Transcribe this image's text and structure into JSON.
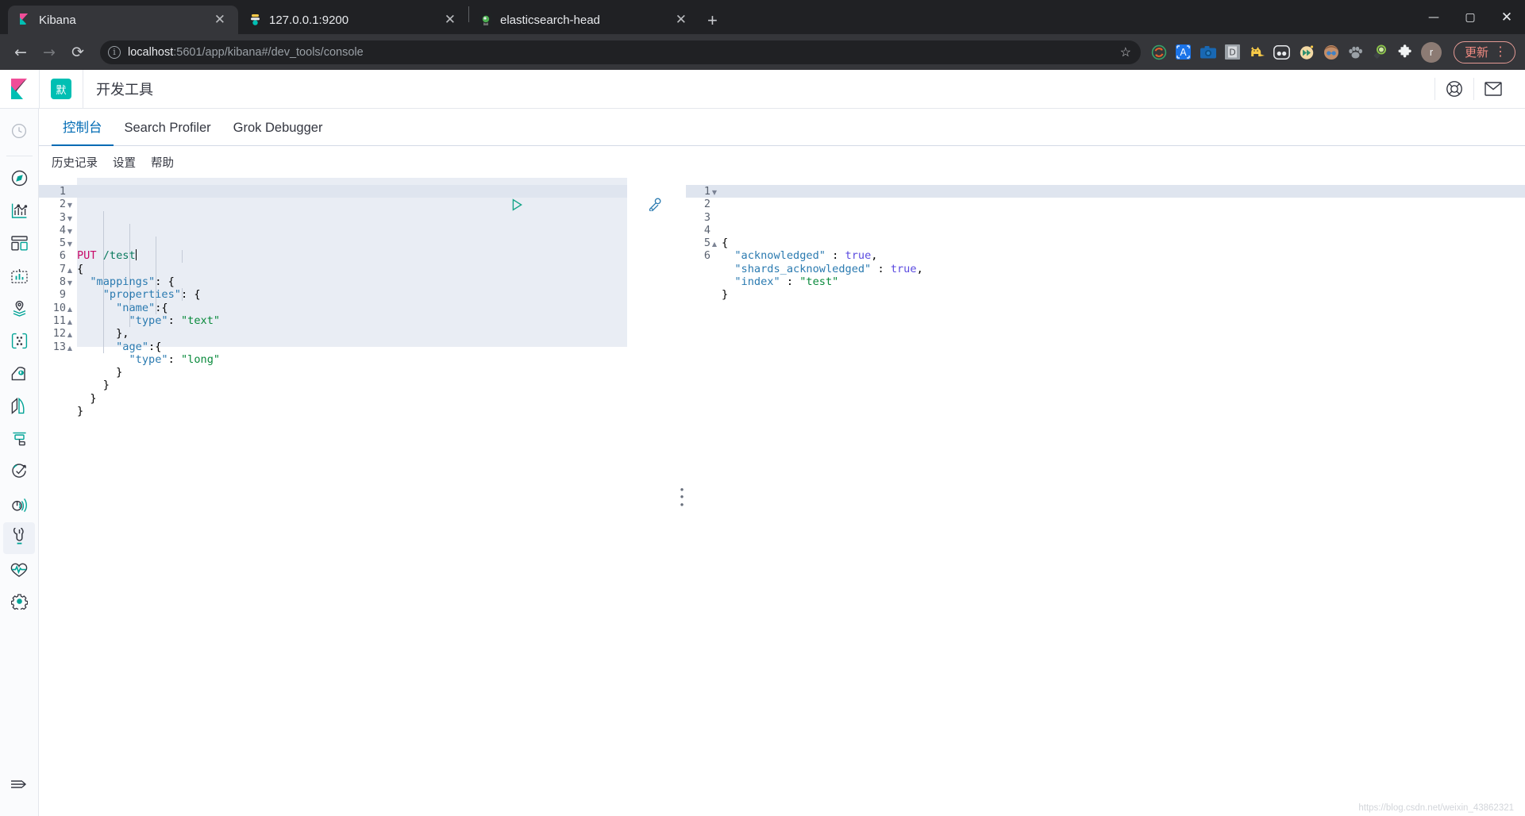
{
  "browser": {
    "tabs": [
      {
        "title": "Kibana",
        "favicon": "kibana-icon",
        "active": true,
        "close_label": "✕"
      },
      {
        "title": "127.0.0.1:9200",
        "favicon": "elasticsearch-icon",
        "active": false,
        "close_label": "✕"
      },
      {
        "title": "elasticsearch-head",
        "favicon": "es-head-icon",
        "active": false,
        "close_label": "✕"
      }
    ],
    "new_tab_label": "+",
    "window_controls": {
      "minimize": "—",
      "maximize": "▢",
      "close": "✕"
    },
    "nav": {
      "back": "←",
      "forward": "→",
      "reload": "⟳"
    },
    "url": {
      "info_glyph": "i",
      "host": "localhost",
      "rest": ":5601/app/kibana#/dev_tools/console",
      "full": "localhost:5601/app/kibana#/dev_tools/console",
      "bookmark_star": "☆"
    },
    "extensions": [
      {
        "name": "sync-extension-icon",
        "glyph": "⟳",
        "color": "#e8622c"
      },
      {
        "name": "letter-a-extension-icon",
        "glyph": "A",
        "color": "#1a73e8"
      },
      {
        "name": "camera-extension-icon",
        "glyph": "📷",
        "color": "#1968b3"
      },
      {
        "name": "letter-d-extension-icon",
        "glyph": "D",
        "color": "#9aa0a6"
      },
      {
        "name": "cat-extension-icon",
        "glyph": "🐈",
        "color": "#f7c948"
      },
      {
        "name": "pocket-extension-icon",
        "glyph": "◠",
        "color": "#e8eaed"
      },
      {
        "name": "fast-forward-extension-icon",
        "glyph": "▶",
        "color": "#f3d9a4"
      },
      {
        "name": "avatar-extension-icon",
        "glyph": "😎",
        "color": "#c28e6a"
      },
      {
        "name": "paw-extension-icon",
        "glyph": "🐾",
        "color": "#9aa0a6"
      },
      {
        "name": "magnifier-extension-icon",
        "glyph": "🔍",
        "color": "#8bc34a"
      },
      {
        "name": "puzzle-extensions-icon",
        "glyph": "🧩",
        "color": "#e8eaed"
      }
    ],
    "profile_initial": "r",
    "update_button_label": "更新",
    "menu_glyph": "⋮"
  },
  "kibana": {
    "logo_name": "kibana-logo",
    "space_badge": "默",
    "app_title": "开发工具",
    "header_icons": [
      {
        "name": "help-lifebuoy-icon",
        "glyph": "help"
      },
      {
        "name": "newsfeed-mail-icon",
        "glyph": "mail"
      }
    ],
    "nav_items": [
      {
        "name": "recently-viewed",
        "icon": "clock-icon",
        "active": false
      },
      {
        "name": "discover",
        "icon": "compass-icon",
        "active": false
      },
      {
        "name": "visualize",
        "icon": "bar-chart-icon",
        "active": false
      },
      {
        "name": "dashboard",
        "icon": "dashboard-grid-icon",
        "active": false
      },
      {
        "name": "canvas",
        "icon": "canvas-frame-icon",
        "active": false
      },
      {
        "name": "maps",
        "icon": "map-pin-layers-icon",
        "active": false
      },
      {
        "name": "machine-learning",
        "icon": "ml-nodes-icon",
        "active": false
      },
      {
        "name": "infrastructure",
        "icon": "infra-icon",
        "active": false
      },
      {
        "name": "logs",
        "icon": "logs-icon",
        "active": false
      },
      {
        "name": "apm",
        "icon": "apm-icon",
        "active": false
      },
      {
        "name": "uptime",
        "icon": "uptime-check-icon",
        "active": false
      },
      {
        "name": "siem",
        "icon": "siem-radar-icon",
        "active": false
      },
      {
        "name": "dev-tools",
        "icon": "wrench-icon",
        "active": true
      },
      {
        "name": "monitoring",
        "icon": "heartbeat-icon",
        "active": false
      },
      {
        "name": "management",
        "icon": "gear-icon",
        "active": false
      }
    ],
    "nav_collapse": {
      "name": "collapse-nav",
      "icon": "collapse-arrow-icon"
    },
    "tabs": [
      {
        "label": "控制台",
        "active": true
      },
      {
        "label": "Search Profiler",
        "active": false
      },
      {
        "label": "Grok Debugger",
        "active": false
      }
    ],
    "console_toolbar": [
      {
        "label": "历史记录"
      },
      {
        "label": "设置"
      },
      {
        "label": "帮助"
      }
    ],
    "editor": {
      "line_count": 13,
      "current_line": 1,
      "folds": {
        "2": "down",
        "3": "down",
        "4": "down",
        "5": "down",
        "7": "up",
        "8": "down",
        "10": "up",
        "11": "up",
        "12": "up",
        "13": "up"
      },
      "lines": [
        "PUT /test",
        "{",
        "  \"mappings\": {",
        "    \"properties\": {",
        "      \"name\":{",
        "        \"type\": \"text\"",
        "      },",
        "      \"age\":{",
        "        \"type\": \"long\"",
        "      }",
        "    }",
        "  }",
        "}"
      ],
      "actions": [
        {
          "name": "send-request-button",
          "icon": "play-triangle-icon"
        },
        {
          "name": "console-wrench-menu-button",
          "icon": "wrench-icon"
        }
      ]
    },
    "output": {
      "line_count": 6,
      "folds": {
        "1": "down",
        "5": "up"
      },
      "lines": [
        "{",
        "  \"acknowledged\" : true,",
        "  \"shards_acknowledged\" : true,",
        "  \"index\" : \"test\"",
        "}",
        ""
      ],
      "values": {
        "acknowledged": true,
        "shards_acknowledged": true,
        "index": "test"
      }
    },
    "splitter": {
      "name": "pane-splitter",
      "glyph": "⋮"
    }
  },
  "watermark": "https://blog.csdn.net/weixin_43862321",
  "colors": {
    "accent_blue": "#006bb4",
    "teal": "#00bfb3",
    "pink": "#f04e98",
    "editor_bg": "#e9edf4",
    "chrome_dark": "#202124",
    "chrome_tabbar": "#35363a",
    "update_red": "#f28b82"
  }
}
